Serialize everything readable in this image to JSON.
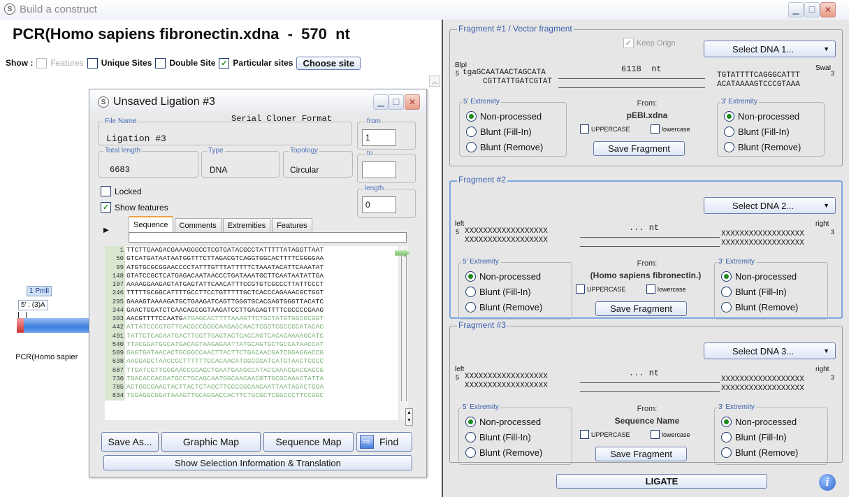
{
  "window": {
    "title": "Build a construct"
  },
  "main": {
    "title": "PCR(Homo sapiens fibronectin.xdna  -  570  nt",
    "show_label": "Show :",
    "features": "Features",
    "unique_sites": "Unique Sites",
    "double_site": "Double Site",
    "particular_sites": "Particular sites",
    "choose_site": "Choose site"
  },
  "map": {
    "enzyme_label": "1  PmlI",
    "extremity": "5' : (3)A",
    "name": "PCR(Homo sapier"
  },
  "ligation": {
    "title": "Unsaved Ligation #3",
    "format": "Serial Cloner Format",
    "file_name_label": "File Name",
    "file_name": "Ligation #3",
    "total_length_label": "Total length",
    "total_length": "6683",
    "type_label": "Type",
    "type": "DNA",
    "topology_label": "Topology",
    "topology": "Circular",
    "from_label": "from",
    "from_value": "1",
    "to_label": "to",
    "to_value": "",
    "length_label": "length",
    "length_value": "0",
    "locked": "Locked",
    "show_features": "Show features",
    "tabs": [
      "Sequence",
      "Comments",
      "Extremities",
      "Features"
    ],
    "lines": [
      {
        "n": "1",
        "s": "TTCTTGAAGACGAAAGGGCCTCGTGATACGCCTATTTTTATAGGTTAAT",
        "g": false
      },
      {
        "n": "50",
        "s": "GTCATGATAATAATGGTTTCTTAGACGTCAGGTGGCACTTTTCGGGGAA",
        "g": false
      },
      {
        "n": "99",
        "s": "ATGTGCGCGGAACCCCTATTTGTTTATTTTTCTAAATACATTCAAATAT",
        "g": false
      },
      {
        "n": "148",
        "s": "GTATCCGCTCATGAGACAATAACCCTGATAAATGCTTCAATAATATTGA",
        "g": false
      },
      {
        "n": "197",
        "s": "AAAAGGAAGAGTATGAGTATTCAACATTTCCGTGTCGCCCTTATTCCCT",
        "g": false
      },
      {
        "n": "246",
        "s": "TTTTTGCGGCATTTTGCCTTCCTGTTTTTGCTCACCCAGAAACGCTGGT",
        "g": false
      },
      {
        "n": "295",
        "s": "GAAAGTAAAAGATGCTGAAGATCAGTTGGGTGCACGAGTGGGTTACATC",
        "g": false
      },
      {
        "n": "344",
        "s": "GAACTGGATCTCAACAGCGGTAAGATCCTTGAGAGTTTTCGCCCCGAAG",
        "g": false
      },
      {
        "n": "393",
        "s": "AACGTTTTCCAATGATGAGCACTTTTAAAGTTCTGCTATGTGGCGCGGT",
        "g": "split"
      },
      {
        "n": "442",
        "s": "ATTATCCCGTGTTGACGCCGGGCAAGAGCAACTCGGTCGCCGCATACAC",
        "g": true
      },
      {
        "n": "491",
        "s": "TATTCTCAGAATGACTTGGTTGAGTACTCACCAGTCACAGAAAAGCATC",
        "g": true
      },
      {
        "n": "540",
        "s": "TTACGGATGGCATGACAGTAAGAGAATTATGCAGTGCTGCCATAACCAT",
        "g": true
      },
      {
        "n": "589",
        "s": "GAGTGATAACACTGCGGCCAACTTACTTCTGACAACGATCGGAGGACCG",
        "g": true
      },
      {
        "n": "638",
        "s": "AAGGAGCTAACCGCTTTTTTGCACAACATGGGGGATCATGTAACTCGCC",
        "g": true
      },
      {
        "n": "687",
        "s": "TTGATCGTTGGGAACCGGAGCTGAATGAAGCCATACCAAACGACGAGCG",
        "g": true
      },
      {
        "n": "736",
        "s": "TGACACCACGATGCCTGCAGCAATGGCAACAACGTTGCGCAAACTATTA",
        "g": true
      },
      {
        "n": "785",
        "s": "ACTGGCGAACTACTTACTCTAGCTTCCCGGCAACAATTAATAGACTGGA",
        "g": true
      },
      {
        "n": "834",
        "s": "TGGAGGCGGATAAAGTTGCAGGACCACTTCTGCGCTCGGCCCTTCCGGC",
        "g": true
      }
    ],
    "buttons": {
      "save_as": "Save As...",
      "graphic_map": "Graphic Map",
      "sequence_map": "Sequence Map",
      "find": "Find",
      "show_selection": "Show Selection Information & Translation"
    }
  },
  "fragments": [
    {
      "label": "Fragment #1 / Vector fragment",
      "keep_origin": "Keep Orign",
      "select": "Select DNA 1...",
      "left_site": "BlpI",
      "right_site": "SwaI",
      "top_left": "tgaGCAATAACTAGCATA",
      "bottom_left": "CGTTATTGATCGTAT",
      "nt": "6118  nt",
      "top_right": "TGTATTTTCAGGGCATTT",
      "bottom_right": "ACATAAAAGTCCCGTAAA",
      "from_label": "From:",
      "from": "pEBI.xdna"
    },
    {
      "label": "Fragment #2",
      "select": "Select DNA 2...",
      "left_site": "left",
      "right_site": "right",
      "top_left": "XXXXXXXXXXXXXXXXXX",
      "bottom_left": "XXXXXXXXXXXXXXXXXX",
      "nt": "... nt",
      "top_right": "XXXXXXXXXXXXXXXXXX",
      "bottom_right": "XXXXXXXXXXXXXXXXXX",
      "from_label": "From:",
      "from": "(Homo sapiens fibronectin.)"
    },
    {
      "label": "Fragment #3",
      "select": "Select DNA 3...",
      "left_site": "left",
      "right_site": "right",
      "top_left": "XXXXXXXXXXXXXXXXXX",
      "bottom_left": "XXXXXXXXXXXXXXXXXX",
      "nt": "... nt",
      "top_right": "XXXXXXXXXXXXXXXXXX",
      "bottom_right": "XXXXXXXXXXXXXXXXXX",
      "from_label": "From:",
      "from": "Sequence Name"
    }
  ],
  "ext": {
    "left": "5' Extremity",
    "right": "3' Extremity",
    "non": "Non-processed",
    "fill": "Blunt (Fill-In)",
    "remove": "Blunt (Remove)",
    "upper": "UPPERCASE",
    "lower": "lowercase",
    "save": "Save Fragment",
    "five": "5",
    "three": "3"
  },
  "ligate": "LIGATE"
}
